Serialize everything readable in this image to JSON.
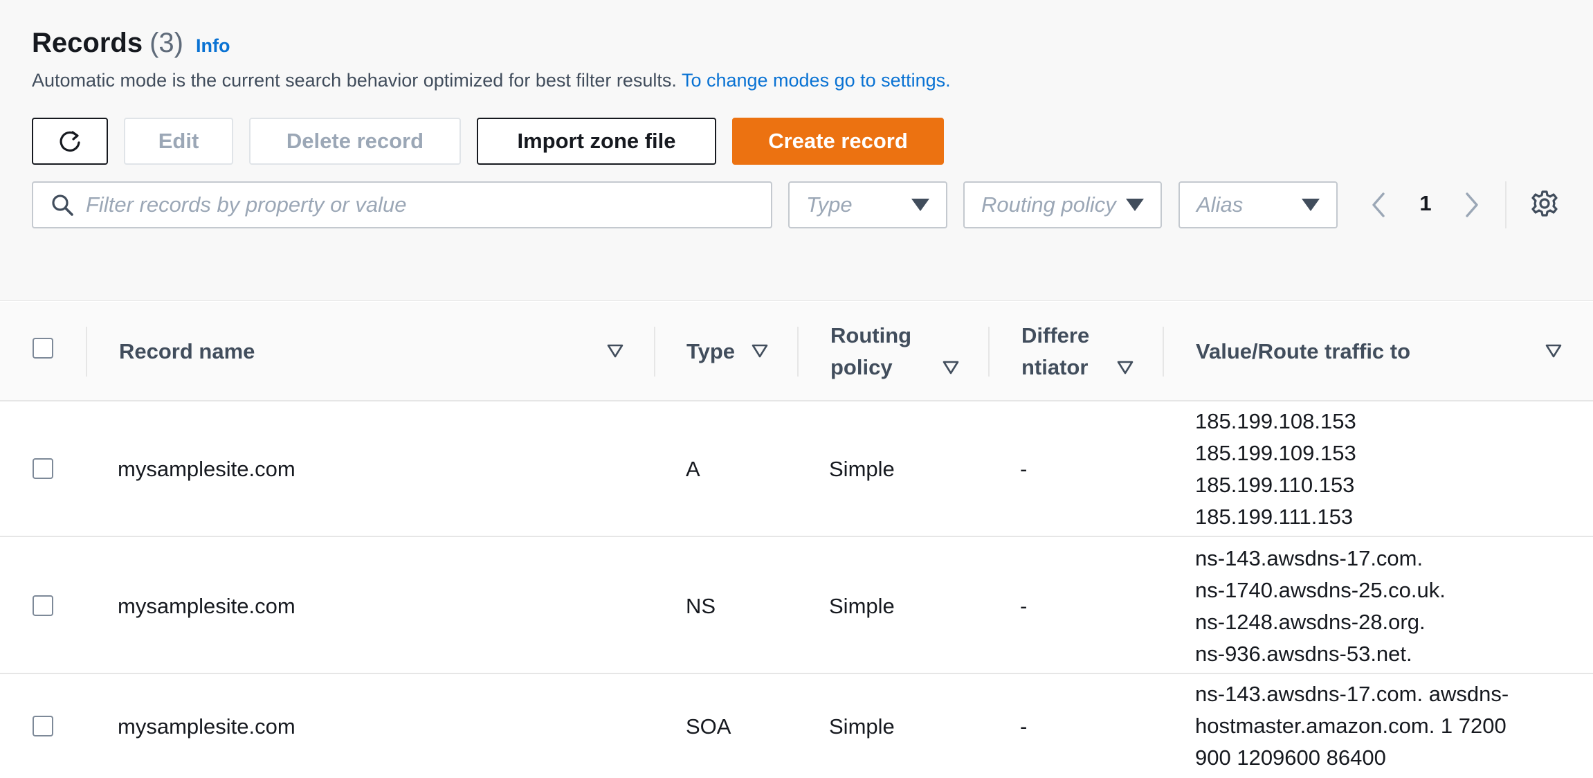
{
  "header": {
    "title": "Records",
    "count": "(3)",
    "info": "Info",
    "description": "Automatic mode is the current search behavior optimized for best filter results.",
    "description_link": "To change modes go to settings."
  },
  "toolbar": {
    "refresh_icon": "refresh-icon",
    "edit_label": "Edit",
    "delete_label": "Delete record",
    "import_label": "Import zone file",
    "create_label": "Create record"
  },
  "filters": {
    "search_placeholder": "Filter records by property or value",
    "type_placeholder": "Type",
    "routing_placeholder": "Routing policy",
    "alias_placeholder": "Alias"
  },
  "pagination": {
    "current_page": "1"
  },
  "table": {
    "columns": [
      {
        "label": "Record name"
      },
      {
        "label": "Type"
      },
      {
        "label": "Routing policy",
        "line1": "Routing",
        "line2": "policy"
      },
      {
        "label": "Differentiator",
        "line1": "Differe",
        "line2": "ntiator"
      },
      {
        "label": "Value/Route traffic to"
      }
    ],
    "rows": [
      {
        "name": "mysamplesite.com",
        "type": "A",
        "routing": "Simple",
        "differentiator": "-",
        "values": [
          "185.199.108.153",
          "185.199.109.153",
          "185.199.110.153",
          "185.199.111.153"
        ]
      },
      {
        "name": "mysamplesite.com",
        "type": "NS",
        "routing": "Simple",
        "differentiator": "-",
        "values": [
          "ns-143.awsdns-17.com.",
          "ns-1740.awsdns-25.co.uk.",
          "ns-1248.awsdns-28.org.",
          "ns-936.awsdns-53.net."
        ]
      },
      {
        "name": "mysamplesite.com",
        "type": "SOA",
        "routing": "Simple",
        "differentiator": "-",
        "values": [
          "ns-143.awsdns-17.com. awsdns-",
          "hostmaster.amazon.com. 1 7200",
          "900 1209600 86400"
        ]
      }
    ]
  },
  "colors": {
    "primary": "#ec7211",
    "link": "#0972d3",
    "text": "#16191f",
    "muted": "#9ba7b6",
    "border": "#e6e6e6"
  }
}
